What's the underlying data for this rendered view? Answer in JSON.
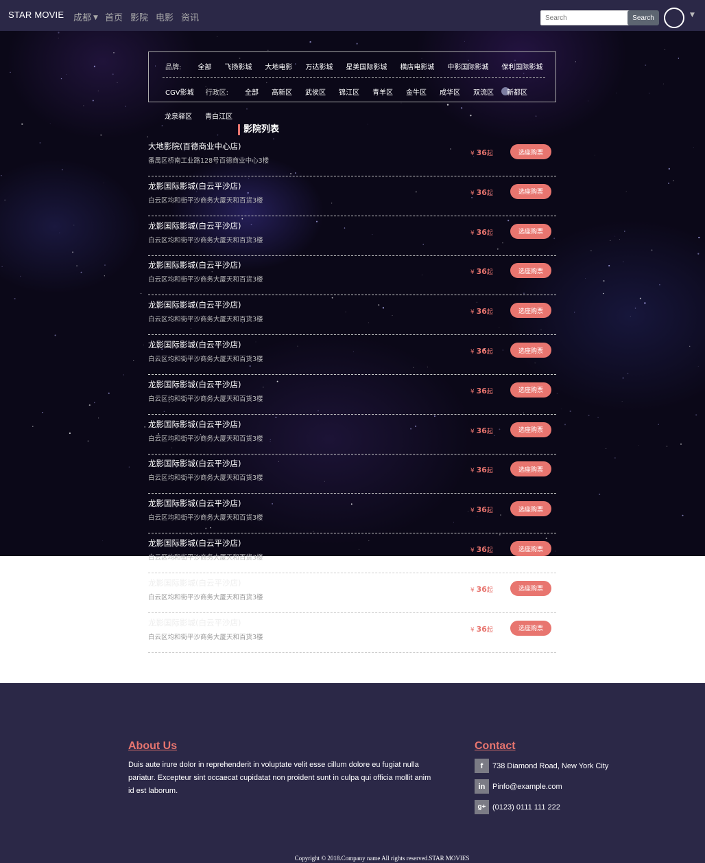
{
  "nav": {
    "brand": "STAR MOVIE",
    "city": "成都",
    "links": [
      "首页",
      "影院",
      "电影",
      "资讯"
    ],
    "search_placeholder": "Search",
    "search_button": "Search"
  },
  "filter": {
    "brand_label": "品牌:",
    "brands": [
      "全部",
      "飞扬影城",
      "大地电影",
      "万达影城",
      "星美国际影城",
      "橫店电影城",
      "中影国际影城",
      "保利国际影城",
      "CGV影城"
    ],
    "district_label": "行政区:",
    "districts": [
      "全部",
      "高新区",
      "武侯区",
      "锦江区",
      "青羊区",
      "金牛区",
      "成华区",
      "双流区",
      "新都区",
      "龙泉驿区",
      "青白江区"
    ]
  },
  "section_title": "影院列表",
  "price_suffix": "起",
  "currency": "¥",
  "buy_label": "选座购票",
  "cinemas": [
    {
      "name": "大地影院(百德商业中心店)",
      "address": "番禺区桥南工业路128号百德商业中心3楼",
      "price": "36"
    },
    {
      "name": "龙影国际影城(白云平沙店)",
      "address": "白云区均和街平沙商务大厦天和百货3楼",
      "price": "36"
    },
    {
      "name": "龙影国际影城(白云平沙店)",
      "address": "白云区均和街平沙商务大厦天和百货3楼",
      "price": "36"
    },
    {
      "name": "龙影国际影城(白云平沙店)",
      "address": "白云区均和街平沙商务大厦天和百货3楼",
      "price": "36"
    },
    {
      "name": "龙影国际影城(白云平沙店)",
      "address": "白云区均和街平沙商务大厦天和百货3楼",
      "price": "36"
    },
    {
      "name": "龙影国际影城(白云平沙店)",
      "address": "白云区均和街平沙商务大厦天和百货3楼",
      "price": "36"
    },
    {
      "name": "龙影国际影城(白云平沙店)",
      "address": "白云区均和街平沙商务大厦天和百货3楼",
      "price": "36"
    },
    {
      "name": "龙影国际影城(白云平沙店)",
      "address": "白云区均和街平沙商务大厦天和百货3楼",
      "price": "36"
    },
    {
      "name": "龙影国际影城(白云平沙店)",
      "address": "白云区均和街平沙商务大厦天和百货3楼",
      "price": "36"
    },
    {
      "name": "龙影国际影城(白云平沙店)",
      "address": "白云区均和街平沙商务大厦天和百货3楼",
      "price": "36"
    },
    {
      "name": "龙影国际影城(白云平沙店)",
      "address": "白云区均和街平沙商务大厦天和百货3楼",
      "price": "36"
    },
    {
      "name": "龙影国际影城(白云平沙店)",
      "address": "白云区均和街平沙商务大厦天和百货3楼",
      "price": "36"
    },
    {
      "name": "龙影国际影城(白云平沙店)",
      "address": "白云区均和街平沙商务大厦天和百货3楼",
      "price": "36"
    }
  ],
  "footer": {
    "about_title": "About Us",
    "about_text": "Duis aute irure dolor in reprehenderit in voluptate velit esse cillum dolore eu fugiat nulla pariatur. Excepteur sint occaecat cupidatat non proident sunt in culpa qui officia mollit anim id est laborum.",
    "contact_title": "Contact",
    "contacts": [
      {
        "icon": "facebook-icon",
        "glyph": "f",
        "text": "738 Diamond Road, New York City"
      },
      {
        "icon": "linkedin-icon",
        "glyph": "in",
        "text": "Pinfo@example.com"
      },
      {
        "icon": "google-plus-icon",
        "glyph": "g+",
        "text": "(0123) 0111 111 222"
      }
    ],
    "copyright": "Copyright © 2018.Company name All rights reserved.STAR MOVIES"
  },
  "colors": {
    "accent": "#e8756f",
    "navbar": "#2b2847",
    "footer": "#2b2847",
    "space": "#0b0818"
  }
}
